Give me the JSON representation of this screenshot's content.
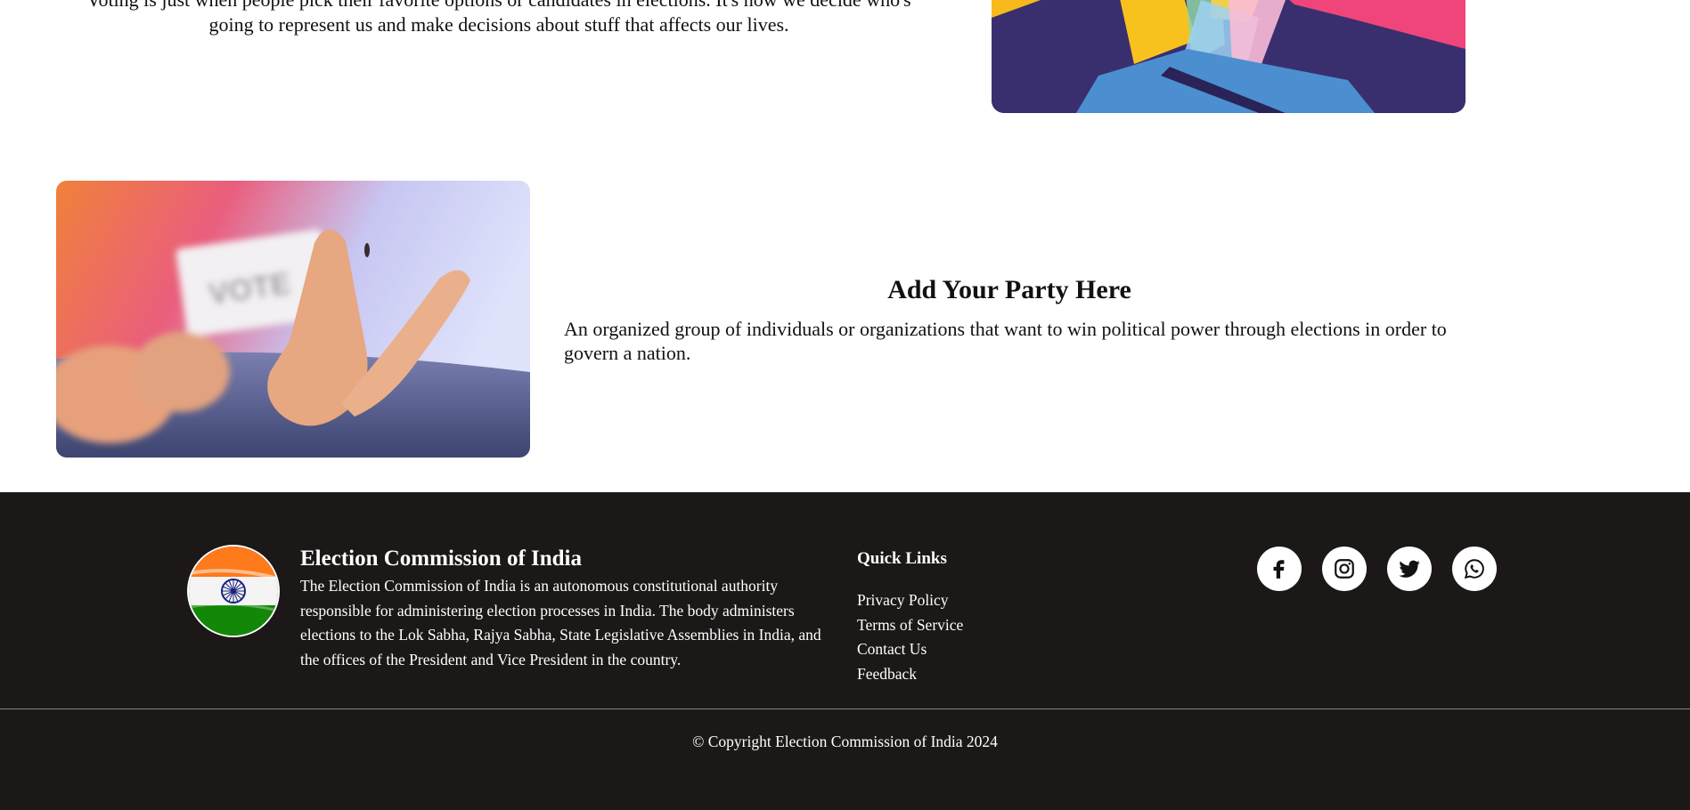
{
  "intro": {
    "text": "Voting is just when people pick their favorite options or candidates in elections. It's how we decide who's going to represent us and make decisions about stuff that affects our lives."
  },
  "party": {
    "title": "Add Your Party Here",
    "description": "An organized group of individuals or organizations that want to win political power through elections in order to govern a nation.",
    "vote_card_text": "VOTE"
  },
  "footer": {
    "org_title": "Election Commission of India",
    "org_description": "The Election Commission of India is an autonomous constitutional authority responsible for administering election processes in India. The body administers elections to the Lok Sabha, Rajya Sabha, State Legislative Assemblies in India, and the offices of the President and Vice President in the country.",
    "quick_links_title": "Quick Links",
    "quick_links": [
      "Privacy Policy",
      "Terms of Service",
      "Contact Us",
      "Feedback"
    ],
    "social_icons": [
      "facebook-icon",
      "instagram-icon",
      "twitter-icon",
      "whatsapp-icon"
    ],
    "copyright": "© Copyright Election Commission of India 2024"
  },
  "colors": {
    "footer_bg": "#1c1818",
    "flag_saffron": "#ff7a1a",
    "flag_green": "#138808",
    "chakra_blue": "#1a237e"
  }
}
